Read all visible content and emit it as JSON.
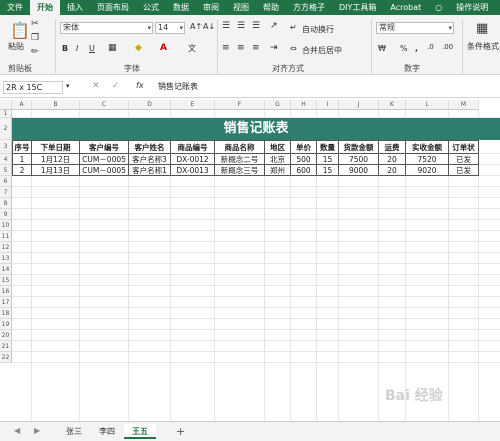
{
  "menu": {
    "tabs": [
      "文件",
      "开始",
      "插入",
      "页面布局",
      "公式",
      "数据",
      "审阅",
      "视图",
      "帮助",
      "方方格子",
      "DIY工具箱",
      "Acrobat"
    ],
    "lightbulb_label": "操作说明"
  },
  "ribbon": {
    "paste_label": "粘贴",
    "clipboard_label": "剪贴板",
    "font_name": "宋体",
    "font_size": "14",
    "bold": "B",
    "italic": "I",
    "underline": "U",
    "font_label": "字体",
    "align_label": "对齐方式",
    "wrap_label": "自动换行",
    "merge_label": "合并后居中",
    "number_format": "常规",
    "currency": "₩",
    "percent": "%",
    "comma": ",",
    "number_label": "数字",
    "cond_format_label": "条件格式"
  },
  "formula_bar": {
    "name_box": "2R x 15C",
    "fx": "fx",
    "formula": "销售记账表"
  },
  "columns": [
    "A",
    "B",
    "C",
    "D",
    "E",
    "F",
    "G",
    "H",
    "I",
    "J",
    "K",
    "L",
    "M"
  ],
  "rows": [
    "1",
    "2",
    "3",
    "4",
    "5",
    "6",
    "7",
    "8",
    "9",
    "10",
    "11",
    "12",
    "13",
    "14",
    "15",
    "16",
    "17",
    "18",
    "19",
    "20",
    "21",
    "22"
  ],
  "sheet": {
    "title": "销售记账表",
    "headers": [
      "序号",
      "下单日期",
      "客户编号",
      "客户姓名",
      "商品编号",
      "商品名称",
      "地区",
      "单价",
      "数量",
      "货款金额",
      "运费",
      "实收金额",
      "订单状"
    ],
    "data": [
      [
        "1",
        "1月12日",
        "CUM－0005",
        "客户名称3",
        "DX-0012",
        "新概念二号",
        "北京",
        "500",
        "15",
        "7500",
        "20",
        "7520",
        "已发"
      ],
      [
        "2",
        "1月13日",
        "CUM－0005",
        "客户名称1",
        "DX-0013",
        "新概念三号",
        "郑州",
        "600",
        "15",
        "9000",
        "20",
        "9020",
        "已发"
      ]
    ]
  },
  "sheet_tabs": [
    "张三",
    "李四",
    "王五"
  ],
  "add_sheet": "+",
  "watermark": "Bai 经验"
}
